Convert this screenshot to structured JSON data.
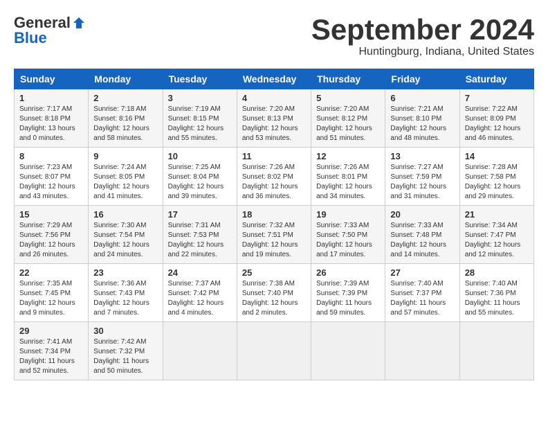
{
  "logo": {
    "general": "General",
    "blue": "Blue"
  },
  "header": {
    "title": "September 2024",
    "subtitle": "Huntingburg, Indiana, United States"
  },
  "weekdays": [
    "Sunday",
    "Monday",
    "Tuesday",
    "Wednesday",
    "Thursday",
    "Friday",
    "Saturday"
  ],
  "weeks": [
    [
      {
        "day": "1",
        "info": "Sunrise: 7:17 AM\nSunset: 8:18 PM\nDaylight: 13 hours\nand 0 minutes."
      },
      {
        "day": "2",
        "info": "Sunrise: 7:18 AM\nSunset: 8:16 PM\nDaylight: 12 hours\nand 58 minutes."
      },
      {
        "day": "3",
        "info": "Sunrise: 7:19 AM\nSunset: 8:15 PM\nDaylight: 12 hours\nand 55 minutes."
      },
      {
        "day": "4",
        "info": "Sunrise: 7:20 AM\nSunset: 8:13 PM\nDaylight: 12 hours\nand 53 minutes."
      },
      {
        "day": "5",
        "info": "Sunrise: 7:20 AM\nSunset: 8:12 PM\nDaylight: 12 hours\nand 51 minutes."
      },
      {
        "day": "6",
        "info": "Sunrise: 7:21 AM\nSunset: 8:10 PM\nDaylight: 12 hours\nand 48 minutes."
      },
      {
        "day": "7",
        "info": "Sunrise: 7:22 AM\nSunset: 8:09 PM\nDaylight: 12 hours\nand 46 minutes."
      }
    ],
    [
      {
        "day": "8",
        "info": "Sunrise: 7:23 AM\nSunset: 8:07 PM\nDaylight: 12 hours\nand 43 minutes."
      },
      {
        "day": "9",
        "info": "Sunrise: 7:24 AM\nSunset: 8:05 PM\nDaylight: 12 hours\nand 41 minutes."
      },
      {
        "day": "10",
        "info": "Sunrise: 7:25 AM\nSunset: 8:04 PM\nDaylight: 12 hours\nand 39 minutes."
      },
      {
        "day": "11",
        "info": "Sunrise: 7:26 AM\nSunset: 8:02 PM\nDaylight: 12 hours\nand 36 minutes."
      },
      {
        "day": "12",
        "info": "Sunrise: 7:26 AM\nSunset: 8:01 PM\nDaylight: 12 hours\nand 34 minutes."
      },
      {
        "day": "13",
        "info": "Sunrise: 7:27 AM\nSunset: 7:59 PM\nDaylight: 12 hours\nand 31 minutes."
      },
      {
        "day": "14",
        "info": "Sunrise: 7:28 AM\nSunset: 7:58 PM\nDaylight: 12 hours\nand 29 minutes."
      }
    ],
    [
      {
        "day": "15",
        "info": "Sunrise: 7:29 AM\nSunset: 7:56 PM\nDaylight: 12 hours\nand 26 minutes."
      },
      {
        "day": "16",
        "info": "Sunrise: 7:30 AM\nSunset: 7:54 PM\nDaylight: 12 hours\nand 24 minutes."
      },
      {
        "day": "17",
        "info": "Sunrise: 7:31 AM\nSunset: 7:53 PM\nDaylight: 12 hours\nand 22 minutes."
      },
      {
        "day": "18",
        "info": "Sunrise: 7:32 AM\nSunset: 7:51 PM\nDaylight: 12 hours\nand 19 minutes."
      },
      {
        "day": "19",
        "info": "Sunrise: 7:33 AM\nSunset: 7:50 PM\nDaylight: 12 hours\nand 17 minutes."
      },
      {
        "day": "20",
        "info": "Sunrise: 7:33 AM\nSunset: 7:48 PM\nDaylight: 12 hours\nand 14 minutes."
      },
      {
        "day": "21",
        "info": "Sunrise: 7:34 AM\nSunset: 7:47 PM\nDaylight: 12 hours\nand 12 minutes."
      }
    ],
    [
      {
        "day": "22",
        "info": "Sunrise: 7:35 AM\nSunset: 7:45 PM\nDaylight: 12 hours\nand 9 minutes."
      },
      {
        "day": "23",
        "info": "Sunrise: 7:36 AM\nSunset: 7:43 PM\nDaylight: 12 hours\nand 7 minutes."
      },
      {
        "day": "24",
        "info": "Sunrise: 7:37 AM\nSunset: 7:42 PM\nDaylight: 12 hours\nand 4 minutes."
      },
      {
        "day": "25",
        "info": "Sunrise: 7:38 AM\nSunset: 7:40 PM\nDaylight: 12 hours\nand 2 minutes."
      },
      {
        "day": "26",
        "info": "Sunrise: 7:39 AM\nSunset: 7:39 PM\nDaylight: 11 hours\nand 59 minutes."
      },
      {
        "day": "27",
        "info": "Sunrise: 7:40 AM\nSunset: 7:37 PM\nDaylight: 11 hours\nand 57 minutes."
      },
      {
        "day": "28",
        "info": "Sunrise: 7:40 AM\nSunset: 7:36 PM\nDaylight: 11 hours\nand 55 minutes."
      }
    ],
    [
      {
        "day": "29",
        "info": "Sunrise: 7:41 AM\nSunset: 7:34 PM\nDaylight: 11 hours\nand 52 minutes."
      },
      {
        "day": "30",
        "info": "Sunrise: 7:42 AM\nSunset: 7:32 PM\nDaylight: 11 hours\nand 50 minutes."
      },
      {
        "day": "",
        "info": ""
      },
      {
        "day": "",
        "info": ""
      },
      {
        "day": "",
        "info": ""
      },
      {
        "day": "",
        "info": ""
      },
      {
        "day": "",
        "info": ""
      }
    ]
  ]
}
